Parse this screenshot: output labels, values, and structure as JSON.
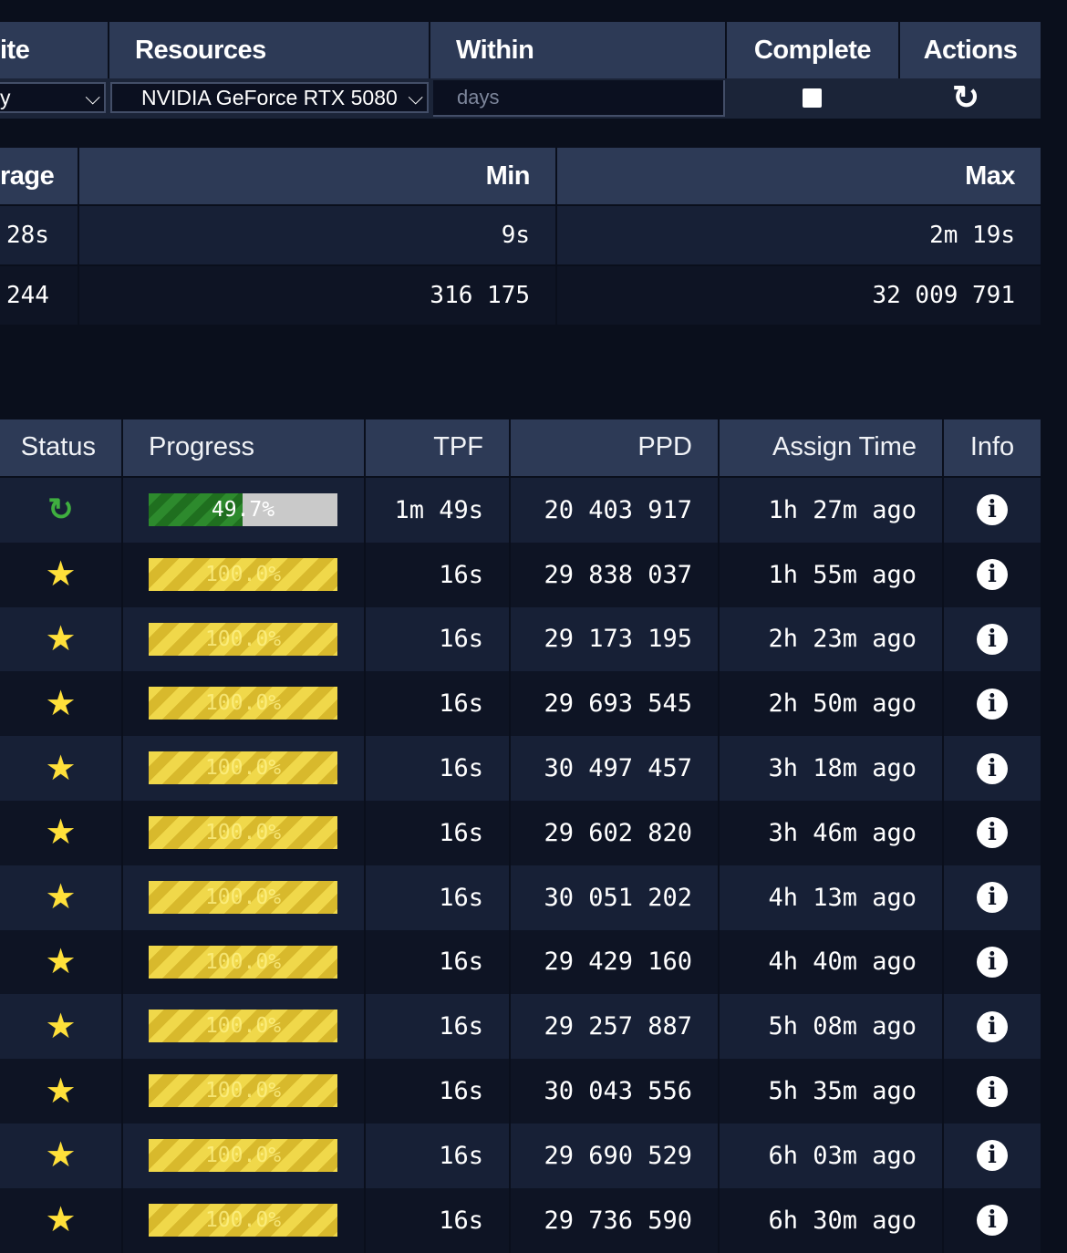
{
  "filter": {
    "headers": {
      "state": "ite",
      "resources": "Resources",
      "within": "Within",
      "complete": "Complete",
      "actions": "Actions"
    },
    "state_value": "y",
    "resources_value": "NVIDIA GeForce RTX 5080",
    "within_placeholder": "days",
    "complete_checked": false,
    "icons": {
      "dropdown": "chevron-down-icon",
      "refresh": "refresh-icon"
    }
  },
  "stats": {
    "headers": {
      "average": "rage",
      "min": "Min",
      "max": "Max"
    },
    "rows": [
      {
        "average": "28s",
        "min": "9s",
        "max": "2m 19s"
      },
      {
        "average": "244",
        "min": "316 175",
        "max": "32 009 791"
      }
    ]
  },
  "jobs": {
    "headers": {
      "status": "Status",
      "progress": "Progress",
      "tpf": "TPF",
      "ppd": "PPD",
      "assign_time": "Assign Time",
      "info": "Info"
    },
    "rows": [
      {
        "status": "running",
        "progress": 49.7,
        "progress_label": "49.7%",
        "tpf": "1m 49s",
        "ppd": "20 403 917",
        "assign": "1h 27m ago"
      },
      {
        "status": "complete",
        "progress": 100,
        "progress_label": "100.0%",
        "tpf": "16s",
        "ppd": "29 838 037",
        "assign": "1h 55m ago"
      },
      {
        "status": "complete",
        "progress": 100,
        "progress_label": "100.0%",
        "tpf": "16s",
        "ppd": "29 173 195",
        "assign": "2h 23m ago"
      },
      {
        "status": "complete",
        "progress": 100,
        "progress_label": "100.0%",
        "tpf": "16s",
        "ppd": "29 693 545",
        "assign": "2h 50m ago"
      },
      {
        "status": "complete",
        "progress": 100,
        "progress_label": "100.0%",
        "tpf": "16s",
        "ppd": "30 497 457",
        "assign": "3h 18m ago"
      },
      {
        "status": "complete",
        "progress": 100,
        "progress_label": "100.0%",
        "tpf": "16s",
        "ppd": "29 602 820",
        "assign": "3h 46m ago"
      },
      {
        "status": "complete",
        "progress": 100,
        "progress_label": "100.0%",
        "tpf": "16s",
        "ppd": "30 051 202",
        "assign": "4h 13m ago"
      },
      {
        "status": "complete",
        "progress": 100,
        "progress_label": "100.0%",
        "tpf": "16s",
        "ppd": "29 429 160",
        "assign": "4h 40m ago"
      },
      {
        "status": "complete",
        "progress": 100,
        "progress_label": "100.0%",
        "tpf": "16s",
        "ppd": "29 257 887",
        "assign": "5h 08m ago"
      },
      {
        "status": "complete",
        "progress": 100,
        "progress_label": "100.0%",
        "tpf": "16s",
        "ppd": "30 043 556",
        "assign": "5h 35m ago"
      },
      {
        "status": "complete",
        "progress": 100,
        "progress_label": "100.0%",
        "tpf": "16s",
        "ppd": "29 690 529",
        "assign": "6h 03m ago"
      },
      {
        "status": "complete",
        "progress": 100,
        "progress_label": "100.0%",
        "tpf": "16s",
        "ppd": "29 736 590",
        "assign": "6h 30m ago"
      }
    ]
  },
  "colors": {
    "header_bg": "#2d3a56",
    "star": "#ffe03a",
    "running": "#3fae3f",
    "complete_bar": "#f0d84a"
  }
}
